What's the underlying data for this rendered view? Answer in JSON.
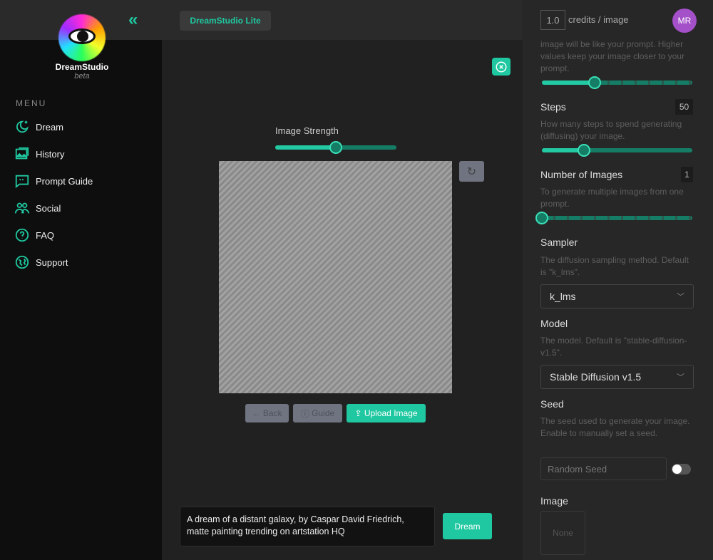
{
  "app": {
    "brand": "DreamStudio",
    "beta": "beta",
    "lite_label": "DreamStudio Lite",
    "accent": "#1fc8a0"
  },
  "sidebar": {
    "menu_heading": "MENU",
    "items": [
      {
        "label": "Dream",
        "icon": "moon-stars-icon"
      },
      {
        "label": "History",
        "icon": "image-gallery-icon"
      },
      {
        "label": "Prompt Guide",
        "icon": "quote-chat-icon"
      },
      {
        "label": "Social",
        "icon": "users-icon"
      },
      {
        "label": "FAQ",
        "icon": "question-circle-icon"
      },
      {
        "label": "Support",
        "icon": "globe-icon"
      }
    ]
  },
  "header": {
    "credits_value": "1.0",
    "credits_label": "credits / image",
    "avatar_initials": "MR",
    "avatar_color": "#a450c8"
  },
  "settings": {
    "cfg": {
      "description": "image will be like your prompt. Higher values keep your image closer to your prompt.",
      "level_percent": 35
    },
    "steps": {
      "label": "Steps",
      "value": "50",
      "description": "How many steps to spend generating (diffusing) your image.",
      "level_percent": 28
    },
    "num_images": {
      "label": "Number of Images",
      "value": "1",
      "description": "To generate multiple images from one prompt.",
      "level_percent": 0
    },
    "sampler": {
      "label": "Sampler",
      "description": "The diffusion sampling method. Default is \"k_lms\".",
      "selected": "k_lms"
    },
    "model": {
      "label": "Model",
      "description": "The model. Default is \"stable-diffusion-v1.5\".",
      "selected": "Stable Diffusion v1.5"
    },
    "seed": {
      "label": "Seed",
      "description": "The seed used to generate your image. Enable to manually set a seed.",
      "placeholder": "Random Seed",
      "enabled": false
    },
    "image": {
      "label": "Image",
      "value": "None"
    }
  },
  "editor": {
    "strength_label": "Image Strength",
    "strength_percent": 50,
    "back_label": "← Back",
    "guide_label": "Guide",
    "upload_label": "Upload Image"
  },
  "prompt": {
    "text": "A dream of a distant galaxy, by Caspar David Friedrich, matte painting trending on artstation HQ",
    "dream_label": "Dream"
  }
}
